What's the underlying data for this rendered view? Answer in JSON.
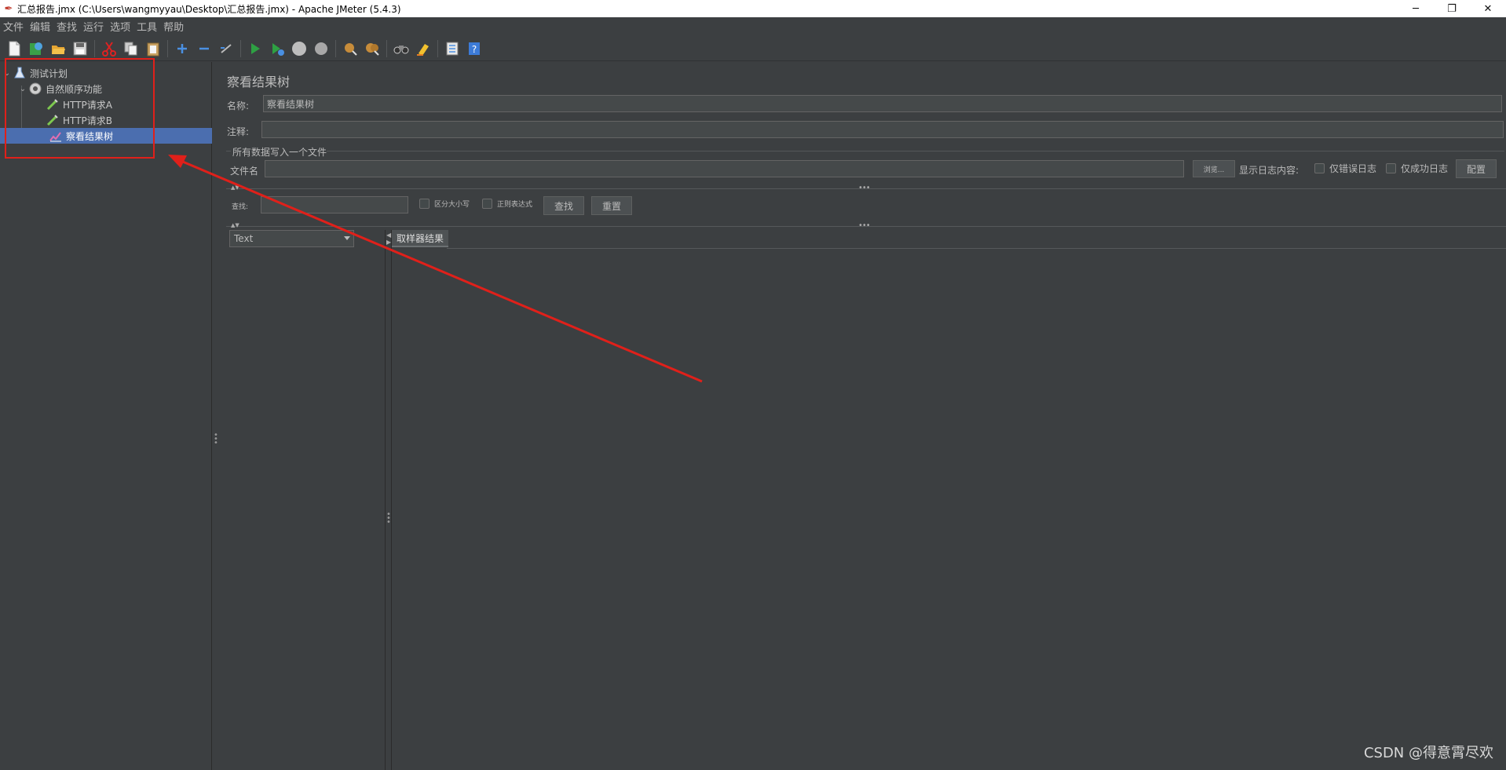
{
  "window": {
    "title": "汇总报告.jmx (C:\\Users\\wangmyyau\\Desktop\\汇总报告.jmx) - Apache JMeter (5.4.3)",
    "minimize": "─",
    "restore": "❐",
    "close": "✕"
  },
  "menubar": [
    "文件",
    "编辑",
    "查找",
    "运行",
    "选项",
    "工具",
    "帮助"
  ],
  "toolbar": {
    "icons": [
      "new-icon",
      "templates-icon",
      "open-icon",
      "save-icon",
      "cut-icon",
      "copy-icon",
      "paste-icon",
      "expand-icon",
      "collapse-icon",
      "toggle-icon",
      "start-icon",
      "start-no-pause-icon",
      "stop-icon",
      "shutdown-icon",
      "clear-icon",
      "clear-all-icon",
      "search-icon",
      "reset-search-icon",
      "function-helper-icon",
      "help-icon"
    ]
  },
  "tree": {
    "items": [
      {
        "label": "测试计划",
        "icon": "test-plan-icon",
        "level": 0
      },
      {
        "label": "自然顺序功能",
        "icon": "thread-group-icon",
        "level": 1
      },
      {
        "label": "HTTP请求A",
        "icon": "http-sampler-icon",
        "level": 2
      },
      {
        "label": "HTTP请求B",
        "icon": "http-sampler-icon",
        "level": 2
      },
      {
        "label": "察看结果树",
        "icon": "listener-icon",
        "level": 2,
        "selected": true
      }
    ]
  },
  "panel": {
    "title": "察看结果树",
    "name_label": "名称:",
    "name_value": "察看结果树",
    "comment_label": "注释:",
    "comment_value": "",
    "file_section_label": "所有数据写入一个文件",
    "filename_label": "文件名",
    "filename_value": "",
    "browse_button": "浏览...",
    "log_display_label": "显示日志内容:",
    "errors_only_label": "仅错误日志",
    "successes_only_label": "仅成功日志",
    "configure_button": "配置",
    "search_label": "查找:",
    "search_value": "",
    "case_sensitive_label": "区分大小写",
    "regex_label": "正则表达式",
    "search_button": "查找",
    "reset_button": "重置",
    "renderer_selected": "Text",
    "sampler_result_tab": "取样器结果"
  },
  "watermark": "CSDN @得意霄尽欢",
  "annotation_color": "#e0201a"
}
